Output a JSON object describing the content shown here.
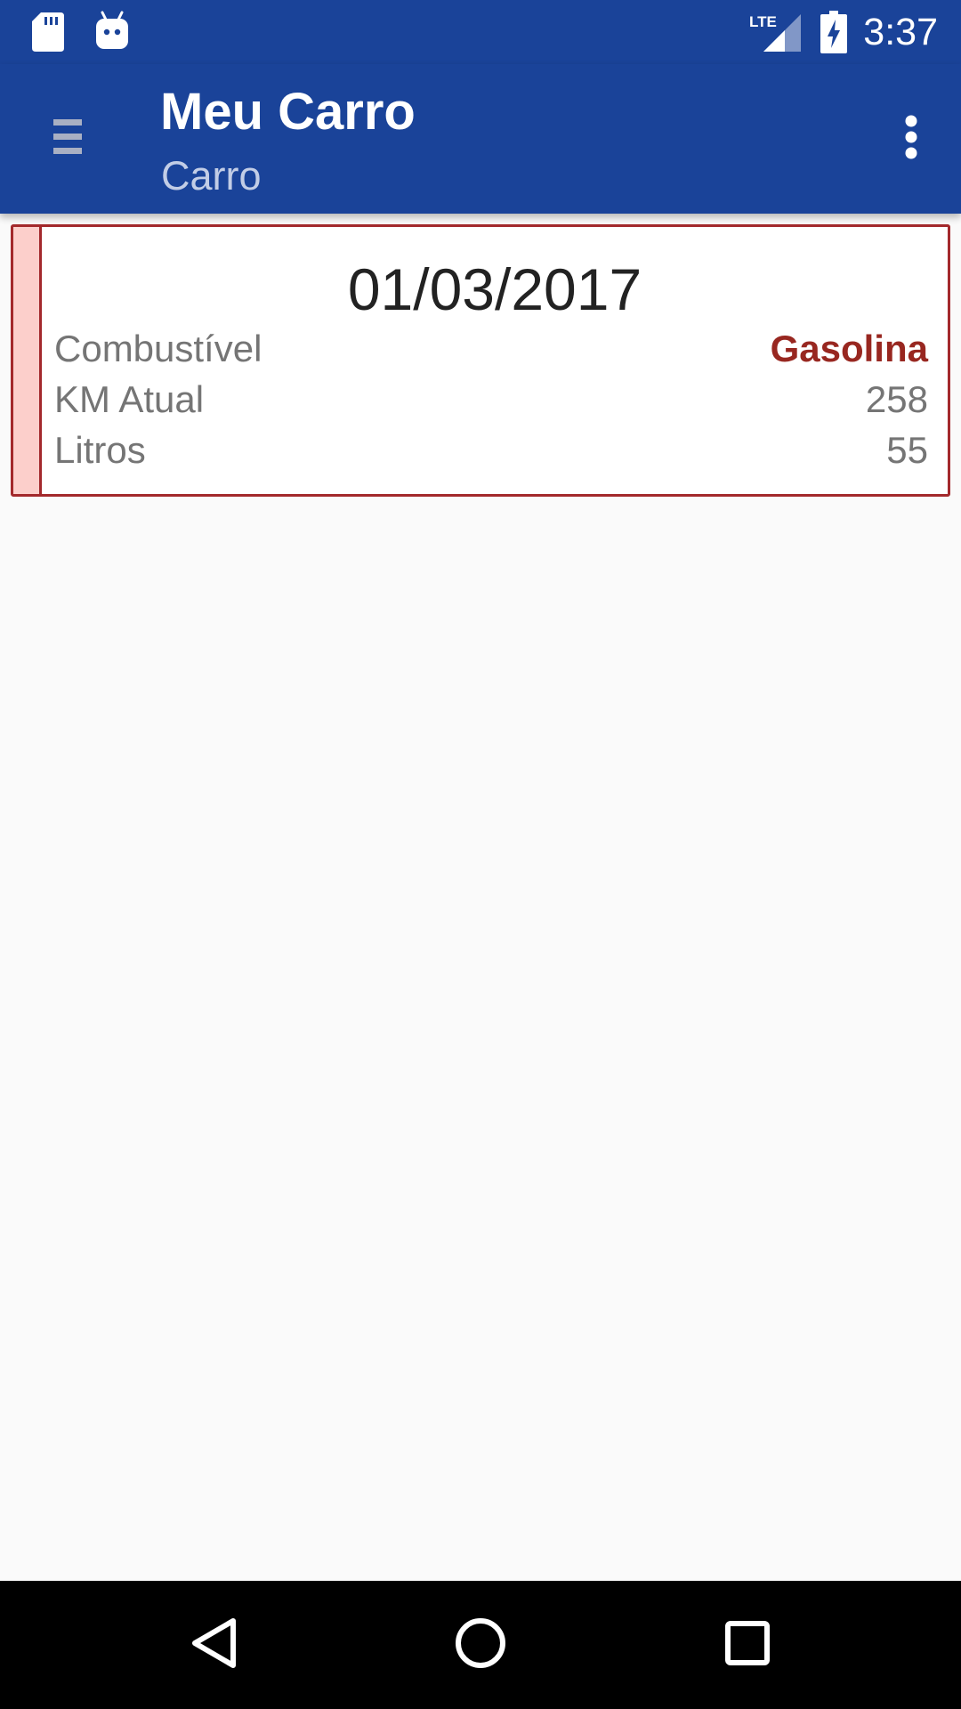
{
  "status_bar": {
    "network": "LTE",
    "time": "3:37",
    "icons": [
      "sd-card-icon",
      "android-debug-icon",
      "lte-signal-icon",
      "battery-charging-icon"
    ]
  },
  "app_bar": {
    "title": "Meu Carro",
    "subtitle": "Carro",
    "icons": [
      "menu-icon",
      "overflow-menu-icon"
    ]
  },
  "records": [
    {
      "date": "01/03/2017",
      "fuel_label": "Combustível",
      "fuel_value": "Gasolina",
      "km_label": "KM Atual",
      "km_value": "258",
      "liters_label": "Litros",
      "liters_value": "55"
    }
  ],
  "nav_bar": {
    "icons": [
      "back-icon",
      "home-icon",
      "recents-icon"
    ]
  },
  "colors": {
    "primary": "#1a4399",
    "card_border": "#a3292c",
    "card_stripe": "#fccfcb",
    "fuel_text": "#982720"
  }
}
